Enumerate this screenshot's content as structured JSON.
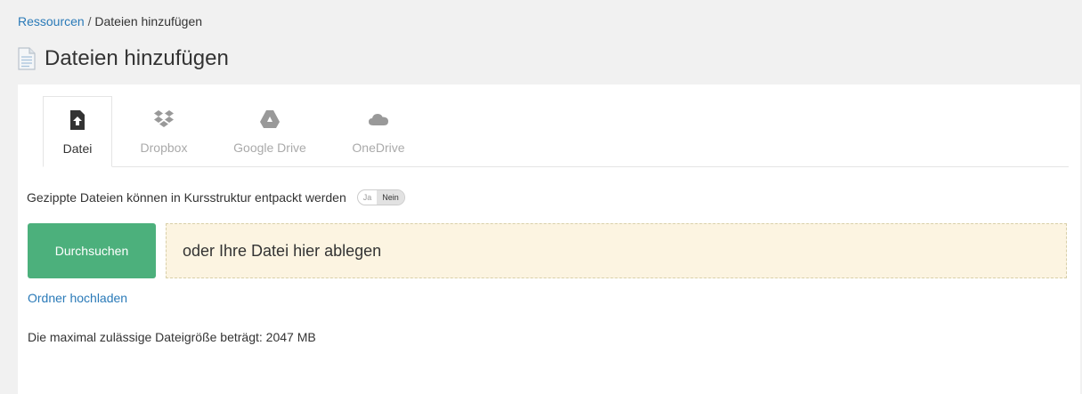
{
  "breadcrumb": {
    "root": "Ressourcen",
    "separator": "/",
    "current": "Dateien hinzufügen"
  },
  "page": {
    "title": "Dateien hinzufügen",
    "title_icon": "document-icon"
  },
  "tabs": [
    {
      "label": "Datei",
      "icon": "file-upload-icon",
      "active": true
    },
    {
      "label": "Dropbox",
      "icon": "dropbox-icon",
      "active": false
    },
    {
      "label": "Google Drive",
      "icon": "google-drive-icon",
      "active": false
    },
    {
      "label": "OneDrive",
      "icon": "onedrive-icon",
      "active": false
    }
  ],
  "unzip": {
    "label": "Gezippte Dateien können in Kursstruktur entpackt werden",
    "option_yes": "Ja",
    "option_no": "Nein",
    "selected": "Nein"
  },
  "upload": {
    "browse_label": "Durchsuchen",
    "dropzone_text": "oder Ihre Datei hier ablegen",
    "folder_link": "Ordner hochladen",
    "max_size_text": "Die maximal zulässige Dateigröße beträgt: 2047 MB"
  },
  "colors": {
    "link": "#2a7ab8",
    "primary_button": "#4cb07c",
    "dropzone_bg": "#fcf4e1",
    "page_bg": "#f1f1f1"
  }
}
